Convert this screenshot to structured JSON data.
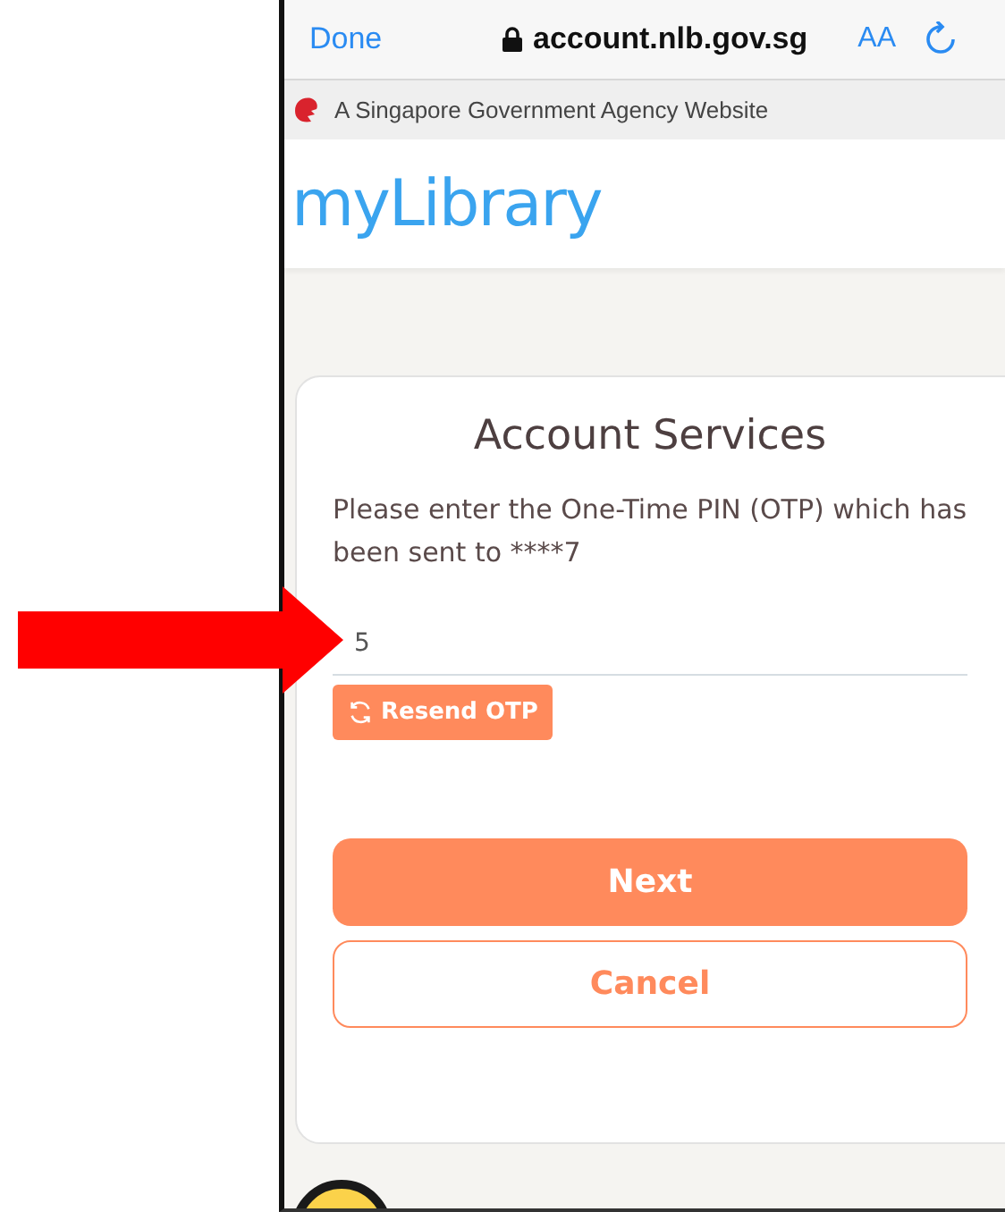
{
  "browser_bar": {
    "done": "Done",
    "url": "account.nlb.gov.sg",
    "text_size": "AA"
  },
  "gov_banner": {
    "text": "A Singapore Government Agency Website"
  },
  "header": {
    "logo": "myLibrary"
  },
  "card": {
    "title": "Account Services",
    "message": "Please enter the One-Time PIN (OTP) which has been sent to ****7",
    "otp_value": "5",
    "resend": "Resend OTP",
    "next": "Next",
    "cancel": "Cancel"
  }
}
